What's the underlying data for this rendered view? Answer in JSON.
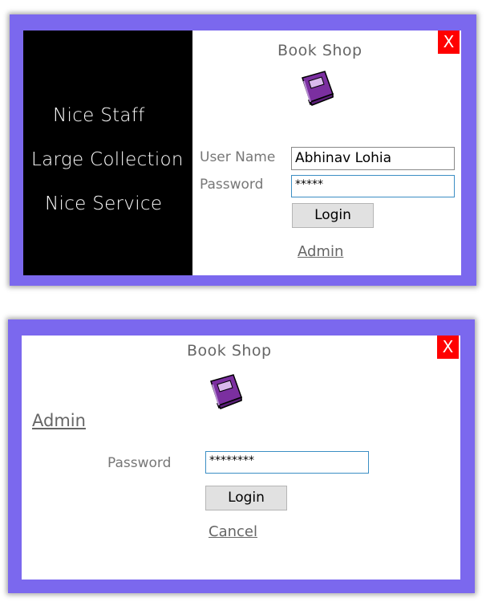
{
  "user_login": {
    "title": "Book Shop",
    "close_label": "X",
    "features": [
      "Nice Staff",
      "Large Collection",
      "Nice Service"
    ],
    "username_label": "User Name",
    "username_value": "Abhinav Lohia",
    "password_label": "Password",
    "password_value": "*****",
    "login_label": "Login",
    "admin_link": "Admin"
  },
  "admin_login": {
    "title": "Book Shop",
    "close_label": "X",
    "heading": "Admin",
    "password_label": "Password",
    "password_value": "********",
    "login_label": "Login",
    "cancel_link": "Cancel"
  },
  "colors": {
    "frame": "#7b68ee",
    "close": "#ff0000",
    "book_cover": "#7b2fa0",
    "book_accent": "#f5c518"
  },
  "icons": {
    "book": "book-icon"
  }
}
